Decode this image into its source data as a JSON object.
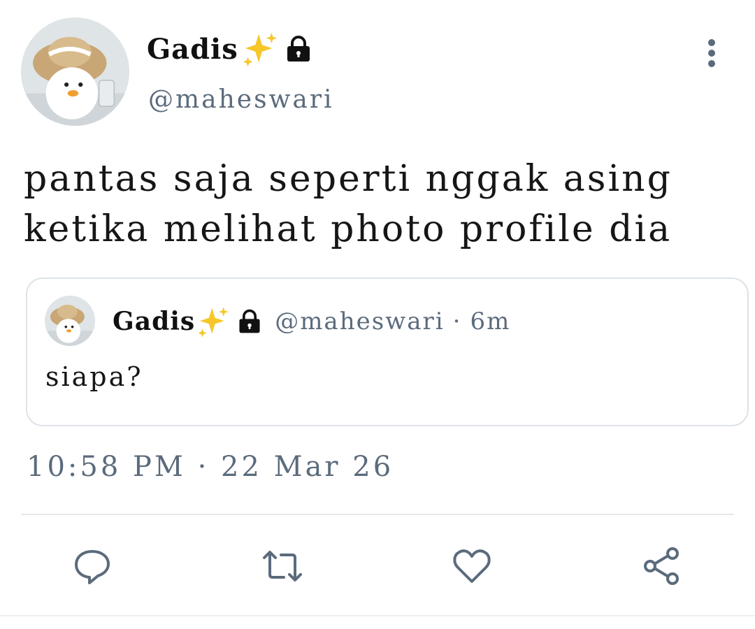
{
  "author": {
    "display_name": "Gadis",
    "username": "@maheswari",
    "badges": [
      "sparkles-icon",
      "lock-icon"
    ]
  },
  "tweet": {
    "text": "pantas saja seperti nggak asing\nketika melihat photo profile dia",
    "timestamp": "10:58 PM · 22 Mar 26"
  },
  "quoted_tweet": {
    "display_name": "Gadis",
    "username": "@maheswari",
    "separator": "·",
    "time_ago": "6m",
    "text": "siapa?"
  },
  "actions": [
    {
      "icon": "reply-icon"
    },
    {
      "icon": "retweet-icon"
    },
    {
      "icon": "like-icon"
    },
    {
      "icon": "share-icon"
    }
  ],
  "colors": {
    "text": "#111111",
    "secondary": "#5b6b7c",
    "border": "#dde3e8",
    "sparkle": "#f7c72a",
    "icon": "#5b6b7c"
  }
}
